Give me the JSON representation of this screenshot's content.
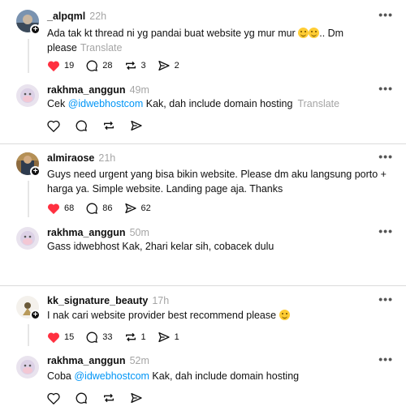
{
  "threads": [
    {
      "post": {
        "username": "_alpqml",
        "time": "22h",
        "text_line1": "Ada tak kt thread ni yg pandai buat website yg mur mur",
        "text_line1_after": ".. Dm",
        "text_line2": "please",
        "translate": "Translate",
        "likes": "19",
        "comments": "28",
        "reposts": "3",
        "shares": "2"
      },
      "reply": {
        "username": "rakhma_anggun",
        "time": "49m",
        "text_before": "Cek ",
        "mention": "@idwebhostcom",
        "text_after": " Kak, dah include domain hosting",
        "translate": "Translate"
      }
    },
    {
      "post": {
        "username": "almiraose",
        "time": "21h",
        "text_line1": "Guys need urgent yang bisa bikin website. Please dm aku langsung porto +",
        "text_line2": "harga ya. Simple website. Landing page aja. Thanks",
        "likes": "68",
        "comments": "86",
        "shares": "62"
      },
      "reply": {
        "username": "rakhma_anggun",
        "time": "50m",
        "text": "Gass idwebhost Kak, 2hari kelar sih, cobacek dulu"
      }
    },
    {
      "post": {
        "username": "kk_signature_beauty",
        "time": "17h",
        "text_line1": "I nak cari website provider best recommend please",
        "likes": "15",
        "comments": "33",
        "reposts": "1",
        "shares": "1"
      },
      "reply": {
        "username": "rakhma_anggun",
        "time": "52m",
        "text_before": "Coba ",
        "mention": "@idwebhostcom",
        "text_after": " Kak, dah include domain hosting"
      }
    }
  ],
  "icons": {
    "like": "heart-icon",
    "comment": "comment-icon",
    "repost": "repost-icon",
    "share": "share-icon",
    "more": "more-icon"
  },
  "colors": {
    "liked": "#ff3040",
    "mention": "#0095f6",
    "muted": "#a5a5a5"
  }
}
